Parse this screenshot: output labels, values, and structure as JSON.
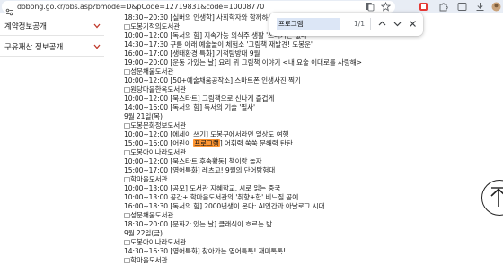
{
  "browser": {
    "url": "dobong.go.kr/bbs.asp?bmode=D&pCode=12719831&code=10008770"
  },
  "sidebar": {
    "items": [
      {
        "label": "계약정보공개"
      },
      {
        "label": "구유재산 정보공개"
      }
    ]
  },
  "find_bar": {
    "query": "프로그램",
    "count": "1/1"
  },
  "content": {
    "lines": [
      "18:30~20:30 [실버의 인생학] 사회학자와 함께하는 ",
      "□도봉기적의도서관",
      "10:00~12:00 [독서의 힘] 지속가능 의식주 생활 '쓰레기는 없다'",
      "14:30~17:30 구름 아래 예술놀이 체험소 '그림책 재발견! 도봉운'",
      "16:00~17:00 [생태환경 특화] 기적탐방대 9월",
      "19:00~20:00 [운동 가있는 날] 요리 뮈 그림책 이야기 <내 요술 이대로를 사랑해>",
      "□성문채울도서관",
      "10:00~12:00 [50+예술채움공작소] 스마트폰 인생사진 찍기",
      "□원당마을한옥도서관",
      "10:00~12:00 [북스타트] 그림책으로 신나게 즐겁게",
      "14:00~16:00 [독서의 힘] 독서의 기술 '필사'",
      "9월 21일(목)",
      "□도봉문화정보도서관",
      "10:00~12:00 [에세이 쓰기] 도봉구에서라면 일상도 여행",
      "15:00~16:00 [어린이 프로그램] 어휘력 쑥쑥 문해력 탄탄",
      "□도봉아이나라도서관",
      "10:00~12:00 [북스타트 후속활동] 책이랑 놀자",
      "15:00~17:00 [영어특화] 레츠고! 9월의 단어탐험대",
      "□학마을도서관",
      "10:00~13:00 [공모] 도서관 지혜학교, 시로 읽는 중국",
      "10:00~13:00 공간+ 학마을도서관의 '취향+한' 비느질 공예",
      "16:00~18:30 [독서의 힘] 2000년생이 온다: AI인간과 아날로그 시대",
      "□성문채울도서관",
      "18:30~20:00 [문화가 있는 날] 클래식이 흐르는 밤",
      "9월 22일(금)",
      "□도봉아이나라도서관",
      "14:30~16:30 [영어특화] 찾아가는 영어특톡! 재미톡톡!",
      "□학마을도서관"
    ],
    "highlight_line_index": 14,
    "highlight_before": "15:00~16:00 [어린이 ",
    "highlight_text": "프로그램",
    "highlight_after": "] 어휘력 쑥쑥 문해력 탄탄"
  },
  "colors": {
    "find_highlight": "#ff9632",
    "toolbar_bg": "#e8edf5"
  },
  "icons": [
    "site-info-icon",
    "translate-icon",
    "bookmark-star-icon",
    "extensions-icon",
    "sidebar-icon",
    "download-icon",
    "profile-icon",
    "chevron-up-icon",
    "chevron-down-icon",
    "close-icon",
    "arrow-up-icon"
  ]
}
